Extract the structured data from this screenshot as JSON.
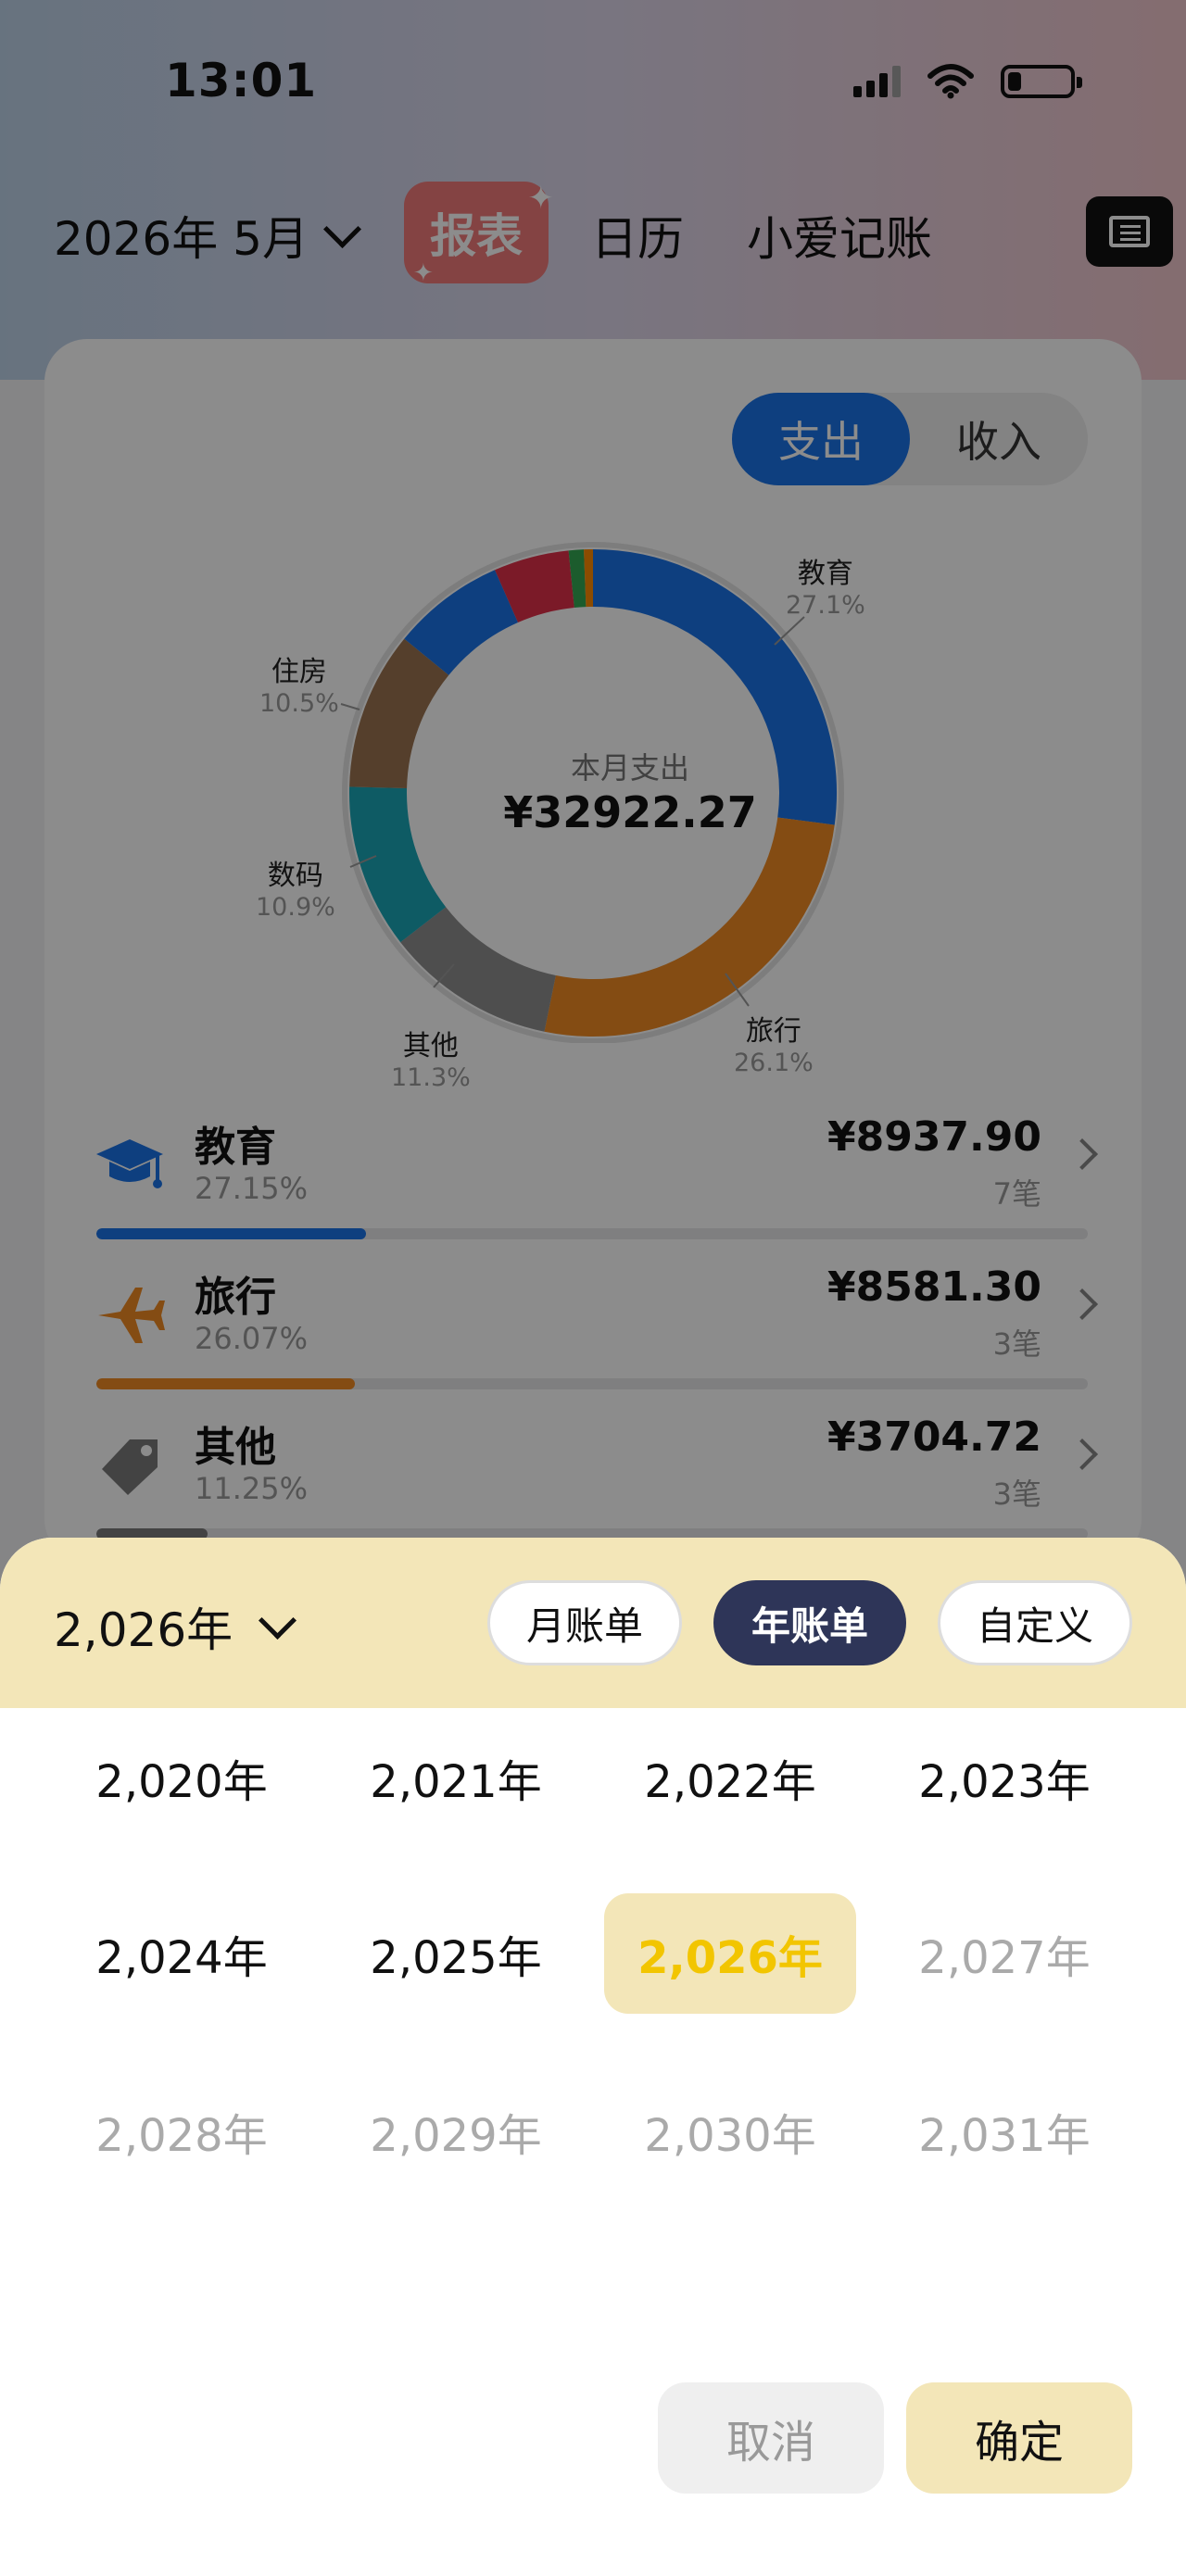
{
  "status_bar": {
    "time": "13:01"
  },
  "top_nav": {
    "month": "2026年 5月",
    "tabs": [
      {
        "label": "报表"
      },
      {
        "label": "日历"
      },
      {
        "label": "小爱记账"
      }
    ]
  },
  "card": {
    "segment": {
      "expense": "支出",
      "income": "收入"
    },
    "center_title": "本月支出",
    "center_value": "¥32922.27",
    "donut_labels": [
      {
        "name": "教育",
        "pct": "27.1%"
      },
      {
        "name": "旅行",
        "pct": "26.1%"
      },
      {
        "name": "其他",
        "pct": "11.3%"
      },
      {
        "name": "数码",
        "pct": "10.9%"
      },
      {
        "name": "住房",
        "pct": "10.5%"
      }
    ],
    "categories": [
      {
        "name": "教育",
        "pct": "27.15%",
        "amount": "¥8937.90",
        "count": "7笔",
        "fill": 0.2715,
        "color": "#1a73e8",
        "icon": "graduation-cap-icon"
      },
      {
        "name": "旅行",
        "pct": "26.07%",
        "amount": "¥8581.30",
        "count": "3笔",
        "fill": 0.2607,
        "color": "#f08a24",
        "icon": "airplane-icon"
      },
      {
        "name": "其他",
        "pct": "11.25%",
        "amount": "¥3704.72",
        "count": "3笔",
        "fill": 0.1125,
        "color": "#7a7a7a",
        "icon": "tag-icon"
      }
    ],
    "donut_colors": {
      "education": "#1a73e8",
      "travel": "#f08a24",
      "other": "#8e8e8e",
      "digital": "#1aa6b7",
      "housing": "#9b7350",
      "blue2": "#1a73e8",
      "red": "#e0304a",
      "green": "#34a853",
      "orange": "#ff8a00"
    }
  },
  "sheet": {
    "year_selector": "2,026年",
    "options": {
      "monthly": "月账单",
      "yearly": "年账单",
      "custom": "自定义"
    },
    "years": [
      [
        "2,020年",
        "2,021年",
        "2,022年",
        "2,023年"
      ],
      [
        "2,024年",
        "2,025年",
        "2,026年",
        "2,027年"
      ],
      [
        "2,028年",
        "2,029年",
        "2,030年",
        "2,031年"
      ]
    ],
    "cancel": "取消",
    "confirm": "确定"
  }
}
